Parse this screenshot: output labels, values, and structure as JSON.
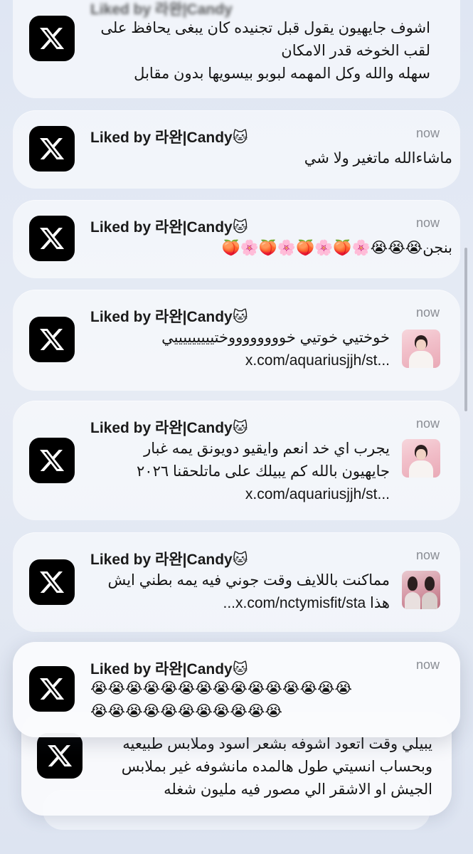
{
  "app": {
    "icon": "x-logo-icon"
  },
  "top_partial": {
    "title": "Liked by 라완|Candy",
    "lines": [
      "اشوف جايهيون يقول قبل تجنيده كان يبغى يحافظ على",
      "لقب الخوخه قدر الامكان",
      "سهله والله وكل المهمه لبوبو بيسويها بدون مقابل"
    ]
  },
  "notifications": [
    {
      "title": "Liked by 라완|Candy",
      "emoji": "🐱",
      "time": "now",
      "lines": [
        "ماشاءالله ماتغير ولا شي"
      ]
    },
    {
      "title": "Liked by 라완|Candy",
      "emoji": "🐱",
      "time": "now",
      "lines": [
        "بنجن😭😭😭🌸🍑🌸🍑🌸🍑🌸🍑"
      ]
    },
    {
      "title": "Liked by 라완|Candy",
      "emoji": "🐱",
      "time": "now",
      "lines": [
        "خوختيي خوتيي خووووووووختيييييييييي",
        "x.com/aquariusjjh/st..."
      ],
      "thumb": "person-photo"
    },
    {
      "title": "Liked by 라완|Candy",
      "emoji": "🐱",
      "time": "now",
      "lines": [
        "يجرب اي خد انعم وايقيو دويونق يمه غبار",
        "جايهيون بالله كم يبيلك على ماتلحقنا ٢٠٢٦",
        "x.com/aquariusjjh/st..."
      ],
      "thumb": "person-photo"
    },
    {
      "title": "Liked by 라완|Candy",
      "emoji": "🐱",
      "time": "now",
      "lines": [
        "مماكنت باللايف وقت جوني فيه يمه بطني ايش",
        "هذا  x.com/nctymisfit/sta..."
      ],
      "thumb": "couple-photo"
    }
  ],
  "front": {
    "title": "Liked by 라완|Candy",
    "emoji": "🐱",
    "time": "now",
    "lines": [
      "😭😭😭😭😭😭😭😭😭😭😭😭😭😭😭",
      "😭😭😭😭😭😭😭😭😭😭😭"
    ]
  },
  "stack_behind": {
    "lines": [
      "يبيلي وقت اتعود اشوفه بشعر اسود وملابس طبيعيه",
      "وبحساب انسيتي طول هالمده مانشوفه غير بملابس",
      "الجيش او الاشقر الي مصور فيه مليون شغله"
    ]
  }
}
